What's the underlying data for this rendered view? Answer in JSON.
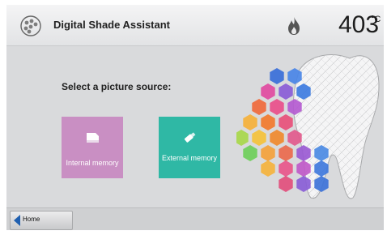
{
  "header": {
    "app_icon": "palette-dots-icon",
    "title": "Digital Shade Assistant",
    "flame_icon": "flame-icon",
    "temperature": "403",
    "unit": "°C"
  },
  "main": {
    "prompt": "Select a picture source:",
    "sources": [
      {
        "label": "Internal memory",
        "icon": "memory-card-icon",
        "color": "#c98fc3"
      },
      {
        "label": "External memory",
        "icon": "usb-stick-icon",
        "color": "#2fb8a5"
      }
    ],
    "illustration": "tooth-hexagon-shade-illustration"
  },
  "footer": {
    "home_label": "Home",
    "home_icon": "back-arrow-icon"
  }
}
